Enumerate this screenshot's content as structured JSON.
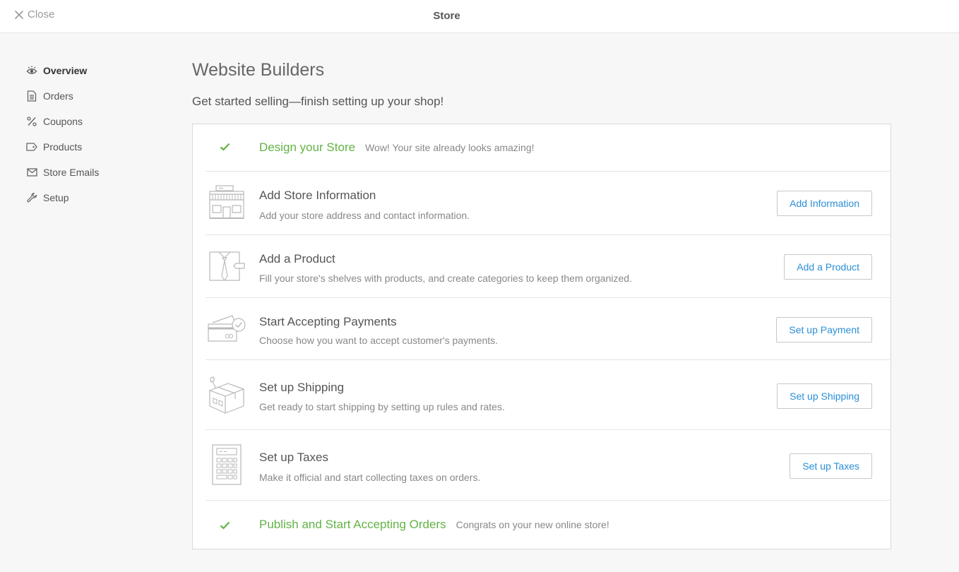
{
  "topbar": {
    "close_label": "Close",
    "title": "Store"
  },
  "sidebar": {
    "items": [
      {
        "label": "Overview",
        "icon": "eye-icon",
        "active": true
      },
      {
        "label": "Orders",
        "icon": "document-icon"
      },
      {
        "label": "Coupons",
        "icon": "percent-icon"
      },
      {
        "label": "Products",
        "icon": "tag-icon"
      },
      {
        "label": "Store Emails",
        "icon": "envelope-icon"
      },
      {
        "label": "Setup",
        "icon": "wrench-icon"
      }
    ]
  },
  "main": {
    "title": "Website Builders",
    "subtitle": "Get started selling—finish setting up your shop!"
  },
  "steps": [
    {
      "title": "Design your Store",
      "description": "Wow! Your site already looks amazing!",
      "completed": true
    },
    {
      "title": "Add Store Information",
      "description": "Add your store address and contact information.",
      "button": "Add Information",
      "icon": "storefront-icon"
    },
    {
      "title": "Add a Product",
      "description": "Fill your store's shelves with products, and create categories to keep them organized.",
      "button": "Add a Product",
      "icon": "shirt-tag-icon"
    },
    {
      "title": "Start Accepting Payments",
      "description": "Choose how you want to accept customer's payments.",
      "button": "Set up Payment",
      "icon": "credit-card-icon"
    },
    {
      "title": "Set up Shipping",
      "description": "Get ready to start shipping by setting up rules and rates.",
      "button": "Set up Shipping",
      "icon": "shipping-box-icon"
    },
    {
      "title": "Set up Taxes",
      "description": "Make it official and start collecting taxes on orders.",
      "button": "Set up Taxes",
      "icon": "calculator-icon"
    },
    {
      "title": "Publish and Start Accepting Orders",
      "description": "Congrats on your new online store!",
      "completed": true
    }
  ],
  "colors": {
    "success": "#62b345",
    "link": "#2a8fd6",
    "border": "#d8d8d8"
  }
}
